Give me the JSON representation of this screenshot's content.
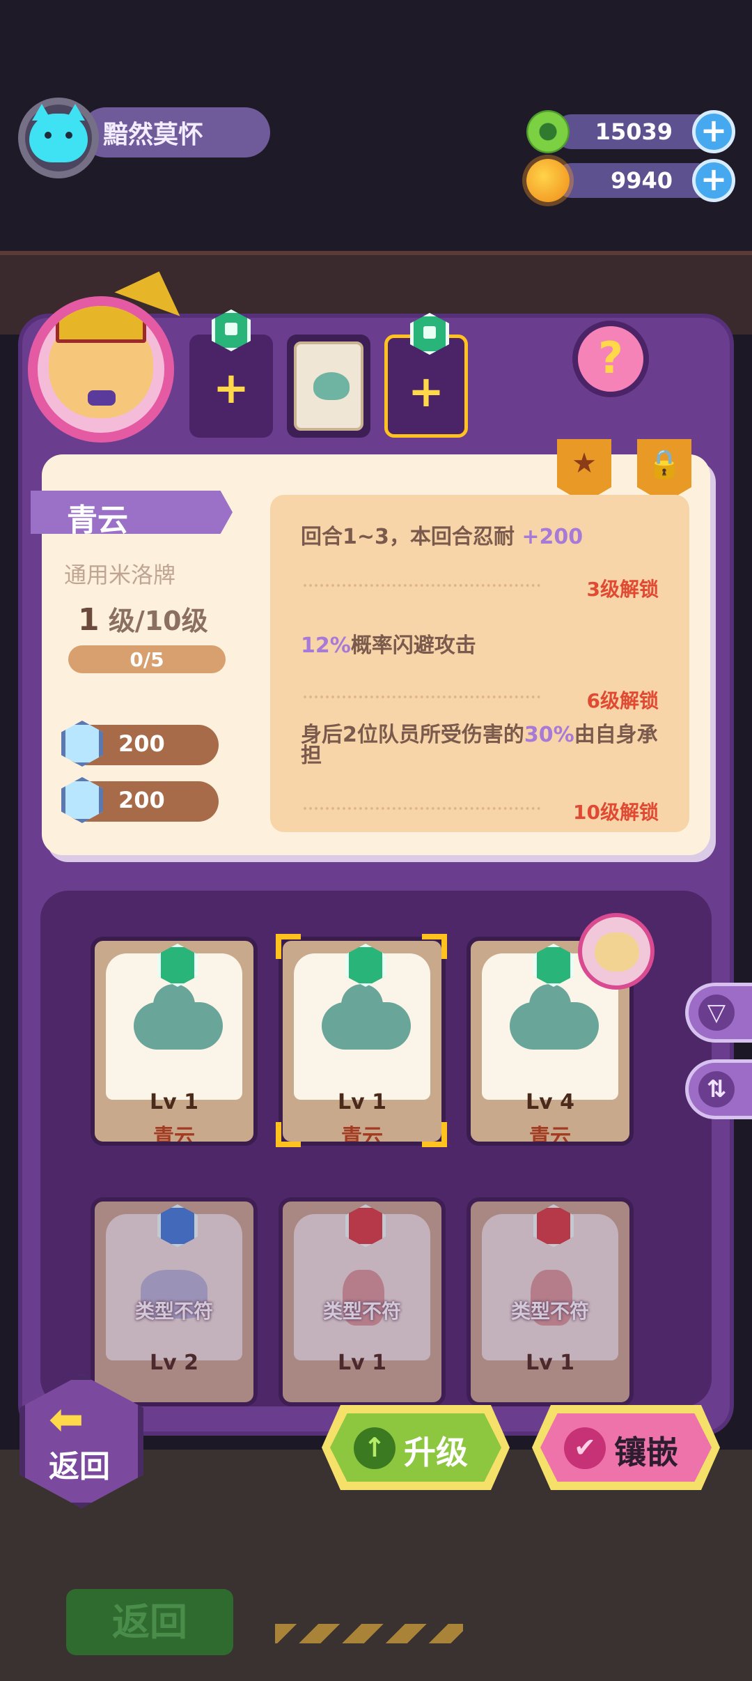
{
  "player": {
    "name": "黯然莫怀"
  },
  "currency": [
    {
      "icon": "donut-icon",
      "value": "15039"
    },
    {
      "icon": "planet-icon",
      "value": "9940"
    }
  ],
  "card_detail": {
    "name": "青云",
    "type": "通用米洛牌",
    "level_current": "1",
    "level_text": "级/10级",
    "progress_text": "0/5",
    "progress_fraction": 0.0,
    "costs": [
      "200",
      "200"
    ],
    "effects": [
      {
        "pre": "回合1~3，本回合忍耐 ",
        "highlight": "+200",
        "post": "",
        "unlock": "3级解锁"
      },
      {
        "pre": "",
        "highlight": "12%",
        "post": "概率闪避攻击",
        "unlock": "6级解锁"
      },
      {
        "pre": "身后2位队员所受伤害的",
        "highlight": "30%",
        "post": "由自身承担",
        "unlock": "10级解锁"
      }
    ]
  },
  "slots": [
    {
      "type": "empty",
      "plus": "+"
    },
    {
      "type": "filled"
    },
    {
      "type": "empty",
      "plus": "+"
    }
  ],
  "help_label": "?",
  "cards": [
    {
      "lv_label": "Lv",
      "lv": "1",
      "name": "青云",
      "state": "normal"
    },
    {
      "lv_label": "Lv",
      "lv": "1",
      "name": "青云",
      "state": "selected"
    },
    {
      "lv_label": "Lv",
      "lv": "4",
      "name": "青云",
      "state": "equipped"
    },
    {
      "lv_label": "Lv",
      "lv": "2",
      "mismatch": "类型不符",
      "state": "dim"
    },
    {
      "lv_label": "Lv",
      "lv": "1",
      "mismatch": "类型不符",
      "state": "dim"
    },
    {
      "lv_label": "Lv",
      "lv": "1",
      "mismatch": "类型不符",
      "state": "dim"
    }
  ],
  "buttons": {
    "back": "返回",
    "back_bg": "返回",
    "upgrade": "升级",
    "embed": "镶嵌"
  },
  "colors": {
    "panel": "#6b3d8f",
    "accent_yellow": "#ffc21e",
    "unlock_red": "#e04a33",
    "highlight_purple": "#a67ad6"
  }
}
